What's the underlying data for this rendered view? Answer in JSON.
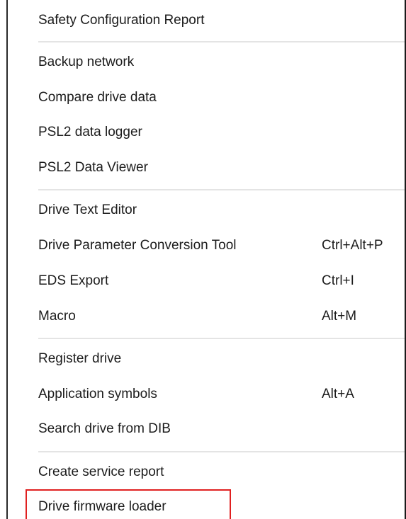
{
  "menu": {
    "groups": [
      {
        "items": [
          {
            "label": "Safety Configuration Report",
            "shortcut": ""
          }
        ]
      },
      {
        "items": [
          {
            "label": "Backup network",
            "shortcut": ""
          },
          {
            "label": "Compare drive data",
            "shortcut": ""
          },
          {
            "label": "PSL2 data logger",
            "shortcut": ""
          },
          {
            "label": "PSL2 Data Viewer",
            "shortcut": ""
          }
        ]
      },
      {
        "items": [
          {
            "label": "Drive Text Editor",
            "shortcut": ""
          },
          {
            "label": "Drive Parameter Conversion Tool",
            "shortcut": "Ctrl+Alt+P"
          },
          {
            "label": "EDS Export",
            "shortcut": "Ctrl+I"
          },
          {
            "label": "Macro",
            "shortcut": "Alt+M"
          }
        ]
      },
      {
        "items": [
          {
            "label": "Register drive",
            "shortcut": ""
          },
          {
            "label": "Application symbols",
            "shortcut": "Alt+A"
          },
          {
            "label": "Search drive from DIB",
            "shortcut": ""
          }
        ]
      },
      {
        "items": [
          {
            "label": "Create service report",
            "shortcut": ""
          },
          {
            "label": "Drive firmware loader",
            "shortcut": ""
          }
        ]
      }
    ]
  },
  "highlight": {
    "color": "#e02020",
    "target": "Drive firmware loader"
  }
}
